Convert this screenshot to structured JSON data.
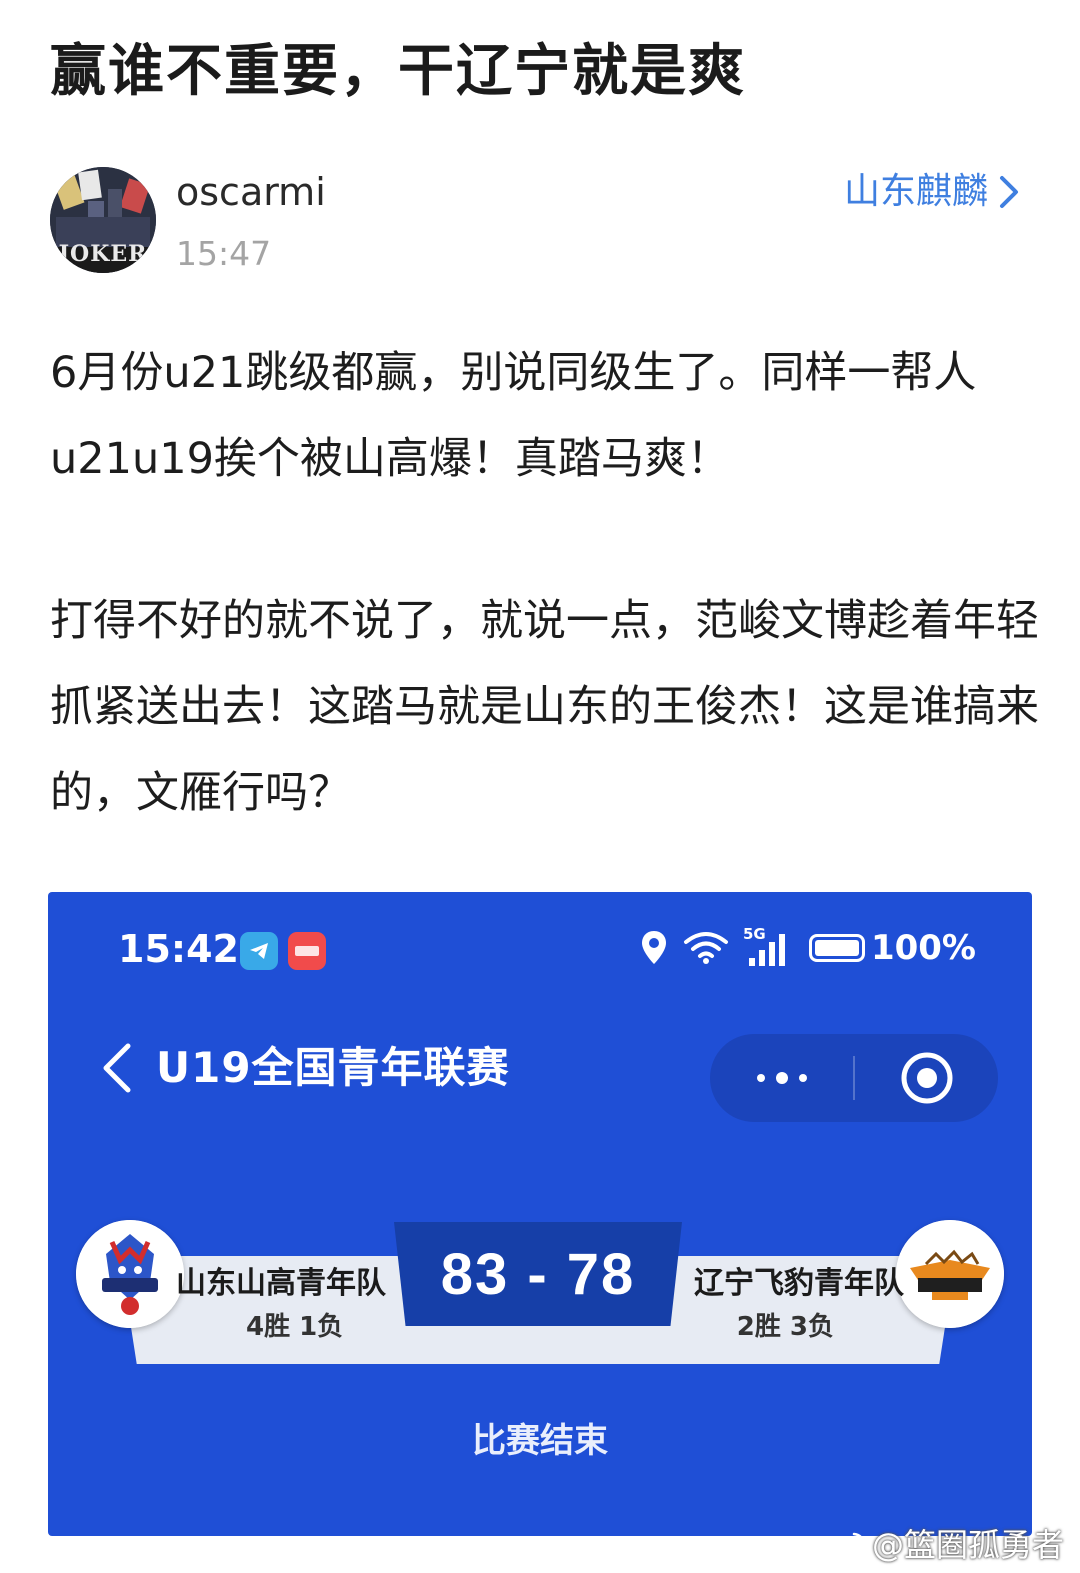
{
  "post": {
    "title": "赢谁不重要，干辽宁就是爽",
    "author": {
      "username": "oscarmi",
      "time": "15:47",
      "avatar_text": "JOKER"
    },
    "topic": "山东麒麟",
    "paragraphs": [
      "6月份u21跳级都赢，别说同级生了。同样一帮人u21u19挨个被山高爆！真踏马爽！",
      "打得不好的就不说了，就说一点，范峻文博趁着年轻抓紧送出去！这踏马就是山东的王俊杰！这是谁搞来的，文雁行吗？"
    ]
  },
  "screenshot": {
    "status_bar": {
      "time": "15:42",
      "network": "5G",
      "battery": "100%",
      "battery_level": 1.0
    },
    "nav": {
      "title": "U19全国青年联赛"
    },
    "match": {
      "home_team": "山东山高青年队",
      "home_record": "4胜 1负",
      "away_team": "辽宁飞豹青年队",
      "away_record": "2胜 3负",
      "score": "83 - 78",
      "home_score": 83,
      "away_score": 78,
      "status": "比赛结束"
    }
  },
  "watermark": "@篮圈孤勇者",
  "colors": {
    "screenshot_bg": "#1f4fd6",
    "score_box": "#163fa8",
    "topic_link": "#3f7fe0"
  },
  "icons": {
    "topic": "chevron-right-icon",
    "back": "chevron-left-icon",
    "more": "more-dots-icon",
    "close": "target-circle-icon",
    "location": "location-pin-icon",
    "wifi": "wifi-icon",
    "signal": "signal-bars-icon",
    "battery": "battery-icon",
    "watermark": "weibo-icon"
  }
}
